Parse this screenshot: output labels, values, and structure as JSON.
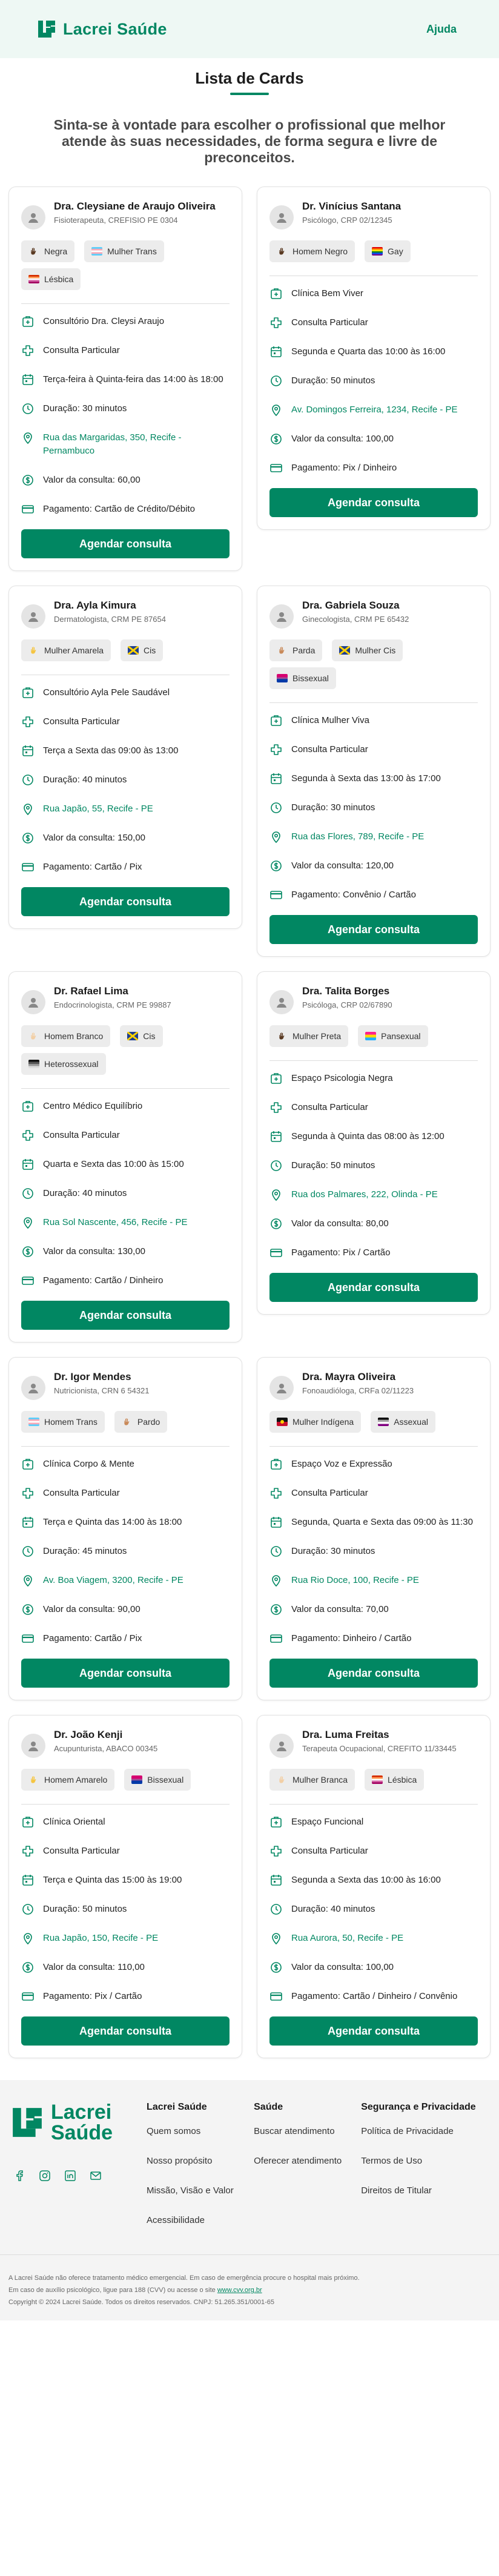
{
  "header": {
    "brand": "Lacrei Saúde",
    "help_label": "Ajuda"
  },
  "page": {
    "title": "Lista de Cards",
    "subtitle": "Sinta-se à vontade para escolher o profissional que melhor atende às suas necessidades, de forma segura e livre de preconceitos."
  },
  "colors": {
    "accent": "#018762",
    "tag_bg": "#ececec",
    "header_bg": "#eef8f4"
  },
  "cta_label": "Agendar consulta",
  "cards": [
    {
      "name": "Dra. Cleysiane de Araujo Oliveira",
      "specialty": "Fisioterapeuta, CREFISIO PE 0304",
      "tags": [
        {
          "label": "Negra",
          "icon": "hand-dark-icon"
        },
        {
          "label": "Mulher Trans",
          "icon": "trans-flag-icon"
        },
        {
          "label": "Lésbica",
          "icon": "lesbian-flag-icon"
        }
      ],
      "clinic": "Consultório Dra. Cleysi Araujo",
      "type": "Consulta Particular",
      "schedule": "Terça-feira à Quinta-feira das 14:00 às 18:00",
      "duration": "Duração: 30 minutos",
      "address": "Rua das Margaridas, 350, Recife - Pernambuco",
      "price": "Valor da consulta: 60,00",
      "payment": "Pagamento: Cartão de Crédito/Débito"
    },
    {
      "name": "Dr. Vinícius Santana",
      "specialty": "Psicólogo, CRP 02/12345",
      "tags": [
        {
          "label": "Homem Negro",
          "icon": "hand-dark-icon"
        },
        {
          "label": "Gay",
          "icon": "gay-flag-icon"
        }
      ],
      "clinic": "Clínica Bem Viver",
      "type": "Consulta Particular",
      "schedule": "Segunda e Quarta das 10:00 às 16:00",
      "duration": "Duração: 50 minutos",
      "address": "Av. Domingos Ferreira, 1234, Recife - PE",
      "price": "Valor da consulta: 100,00",
      "payment": "Pagamento: Pix / Dinheiro"
    },
    {
      "name": "Dra. Ayla Kimura",
      "specialty": "Dermatologista, CRM PE 87654",
      "tags": [
        {
          "label": "Mulher Amarela",
          "icon": "hand-yellow-icon"
        },
        {
          "label": "Cis",
          "icon": "cis-flag-icon"
        }
      ],
      "clinic": "Consultório Ayla Pele Saudável",
      "type": "Consulta Particular",
      "schedule": "Terça a Sexta das 09:00 às 13:00",
      "duration": "Duração: 40 minutos",
      "address": "Rua Japão, 55, Recife - PE",
      "price": "Valor da consulta: 150,00",
      "payment": "Pagamento: Cartão / Pix"
    },
    {
      "name": "Dra. Gabriela Souza",
      "specialty": "Ginecologista, CRM PE 65432",
      "tags": [
        {
          "label": "Parda",
          "icon": "hand-medium-icon"
        },
        {
          "label": "Mulher Cis",
          "icon": "cis-flag-icon"
        },
        {
          "label": "Bissexual",
          "icon": "bi-flag-icon"
        }
      ],
      "clinic": "Clínica Mulher Viva",
      "type": "Consulta Particular",
      "schedule": "Segunda à Sexta das 13:00 às 17:00",
      "duration": "Duração: 30 minutos",
      "address": "Rua das Flores, 789, Recife - PE",
      "price": "Valor da consulta: 120,00",
      "payment": "Pagamento: Convênio / Cartão"
    },
    {
      "name": "Dr. Rafael Lima",
      "specialty": "Endocrinologista, CRM PE 99887",
      "tags": [
        {
          "label": "Homem Branco",
          "icon": "hand-light-icon"
        },
        {
          "label": "Cis",
          "icon": "cis-flag-icon"
        },
        {
          "label": "Heterossexual",
          "icon": "hetero-flag-icon"
        }
      ],
      "clinic": "Centro Médico Equilíbrio",
      "type": "Consulta Particular",
      "schedule": "Quarta e Sexta das 10:00 às 15:00",
      "duration": "Duração: 40 minutos",
      "address": "Rua Sol Nascente, 456, Recife - PE",
      "price": "Valor da consulta: 130,00",
      "payment": "Pagamento: Cartão / Dinheiro"
    },
    {
      "name": "Dra. Talita Borges",
      "specialty": "Psicóloga, CRP 02/67890",
      "tags": [
        {
          "label": "Mulher Preta",
          "icon": "hand-dark-icon"
        },
        {
          "label": "Pansexual",
          "icon": "pan-flag-icon"
        }
      ],
      "clinic": "Espaço Psicologia Negra",
      "type": "Consulta Particular",
      "schedule": "Segunda à Quinta das 08:00 às 12:00",
      "duration": "Duração: 50 minutos",
      "address": "Rua dos Palmares, 222, Olinda - PE",
      "price": "Valor da consulta: 80,00",
      "payment": "Pagamento: Pix / Cartão"
    },
    {
      "name": "Dr. Igor Mendes",
      "specialty": "Nutricionista, CRN 6 54321",
      "tags": [
        {
          "label": "Homem Trans",
          "icon": "trans-flag-icon"
        },
        {
          "label": "Pardo",
          "icon": "hand-medium-icon"
        }
      ],
      "clinic": "Clínica Corpo & Mente",
      "type": "Consulta Particular",
      "schedule": "Terça e Quinta das 14:00 às 18:00",
      "duration": "Duração: 45 minutos",
      "address": "Av. Boa Viagem, 3200, Recife - PE",
      "price": "Valor da consulta: 90,00",
      "payment": "Pagamento: Cartão / Pix"
    },
    {
      "name": "Dra. Mayra Oliveira",
      "specialty": "Fonoaudióloga, CRFa 02/11223",
      "tags": [
        {
          "label": "Mulher Indígena",
          "icon": "indigenous-flag-icon"
        },
        {
          "label": "Assexual",
          "icon": "ace-flag-icon"
        }
      ],
      "clinic": "Espaço Voz e Expressão",
      "type": "Consulta Particular",
      "schedule": "Segunda, Quarta e Sexta das 09:00 às 11:30",
      "duration": "Duração: 30 minutos",
      "address": "Rua Rio Doce, 100, Recife - PE",
      "price": "Valor da consulta: 70,00",
      "payment": "Pagamento: Dinheiro / Cartão"
    },
    {
      "name": "Dr. João Kenji",
      "specialty": "Acupunturista, ABACO 00345",
      "tags": [
        {
          "label": "Homem Amarelo",
          "icon": "hand-yellow-icon"
        },
        {
          "label": "Bissexual",
          "icon": "bi-flag-icon"
        }
      ],
      "clinic": "Clínica Oriental",
      "type": "Consulta Particular",
      "schedule": "Terça e Quinta das 15:00 às 19:00",
      "duration": "Duração: 50 minutos",
      "address": "Rua Japão, 150, Recife - PE",
      "price": "Valor da consulta: 110,00",
      "payment": "Pagamento: Pix / Cartão"
    },
    {
      "name": "Dra. Luma Freitas",
      "specialty": "Terapeuta Ocupacional, CREFITO 11/33445",
      "tags": [
        {
          "label": "Mulher Branca",
          "icon": "hand-light-icon"
        },
        {
          "label": "Lésbica",
          "icon": "lesbian-flag-icon"
        }
      ],
      "clinic": "Espaço Funcional",
      "type": "Consulta Particular",
      "schedule": "Segunda a Sexta das 10:00 às 16:00",
      "duration": "Duração: 40 minutos",
      "address": "Rua Aurora, 50, Recife - PE",
      "price": "Valor da consulta: 100,00",
      "payment": "Pagamento: Cartão / Dinheiro / Convênio"
    }
  ],
  "footer": {
    "brand_line1": "Lacrei",
    "brand_line2": "Saúde",
    "socials": [
      "facebook-icon",
      "instagram-icon",
      "linkedin-icon",
      "email-icon"
    ],
    "columns": [
      {
        "title": "Lacrei Saúde",
        "links": [
          "Quem somos",
          "Nosso propósito",
          "Missão, Visão e Valor",
          "Acessibilidade"
        ]
      },
      {
        "title": "Saúde",
        "links": [
          "Buscar atendimento",
          "Oferecer atendimento"
        ]
      },
      {
        "title": "Segurança e Privacidade",
        "links": [
          "Política de Privacidade",
          "Termos de Uso",
          "Direitos de Titular"
        ]
      }
    ],
    "disclaimer1": "A Lacrei Saúde não oferece tratamento médico emergencial. Em caso de emergência procure o hospital mais próximo.",
    "disclaimer2_prefix": "Em caso de auxílio psicológico, ligue para 188 (CVV) ou acesse o site",
    "disclaimer2_link": "www.cvv.org.br",
    "copyright": "Copyright © 2024 Lacrei Saúde. Todos os direitos reservados. CNPJ: 51.265.351/0001-65"
  }
}
